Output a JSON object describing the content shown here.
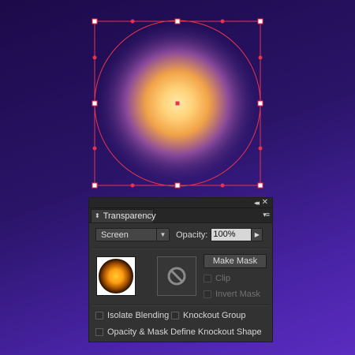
{
  "panel": {
    "tab_label": "Transparency",
    "collapse_glyph": "◂◂",
    "close_glyph": "✕",
    "menu_glyph": "▾≡",
    "blend_mode": "Screen",
    "opacity_label": "Opacity:",
    "opacity_value": "100%",
    "make_mask_label": "Make Mask",
    "clip_label": "Clip",
    "invert_mask_label": "Invert Mask",
    "isolate_blending_label": "Isolate Blending",
    "knockout_group_label": "Knockout Group",
    "define_knockout_label": "Opacity & Mask Define Knockout Shape"
  },
  "colors": {
    "selection": "#e8334f",
    "panel_bg": "#323232",
    "glow_core": "#ffe9a8",
    "glow_mid": "#ffa83a"
  }
}
